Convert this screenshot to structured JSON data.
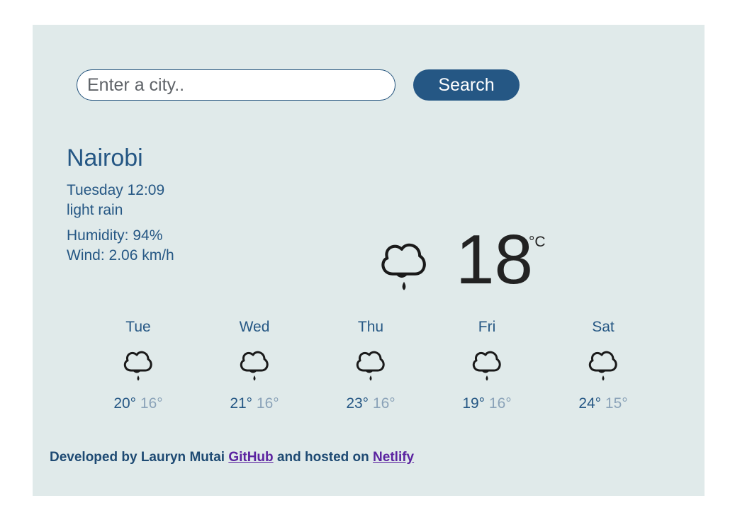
{
  "search": {
    "placeholder": "Enter a city..",
    "value": "",
    "button_label": "Search"
  },
  "current": {
    "city": "Nairobi",
    "datetime": "Tuesday 12:09",
    "description": "light rain",
    "humidity": "Humidity: 94%",
    "wind": "Wind: 2.06 km/h",
    "temperature": "18",
    "unit": "°C",
    "icon": "cloud-rain-icon"
  },
  "forecast": [
    {
      "day": "Tue",
      "max": "20°",
      "min": "16°",
      "icon": "cloud-rain-icon"
    },
    {
      "day": "Wed",
      "max": "21°",
      "min": "16°",
      "icon": "cloud-rain-icon"
    },
    {
      "day": "Thu",
      "max": "23°",
      "min": "16°",
      "icon": "cloud-rain-icon"
    },
    {
      "day": "Fri",
      "max": "19°",
      "min": "16°",
      "icon": "cloud-rain-icon"
    },
    {
      "day": "Sat",
      "max": "24°",
      "min": "15°",
      "icon": "cloud-rain-icon"
    }
  ],
  "footer": {
    "prefix": "Developed by Lauryn Mutai",
    "github_label": "GitHub",
    "middle": "and hosted on",
    "netlify_label": "Netlify"
  },
  "colors": {
    "background": "#e0eaea",
    "accent": "#255784",
    "min_temp": "#8aa2b8",
    "link": "#5b23a0"
  }
}
